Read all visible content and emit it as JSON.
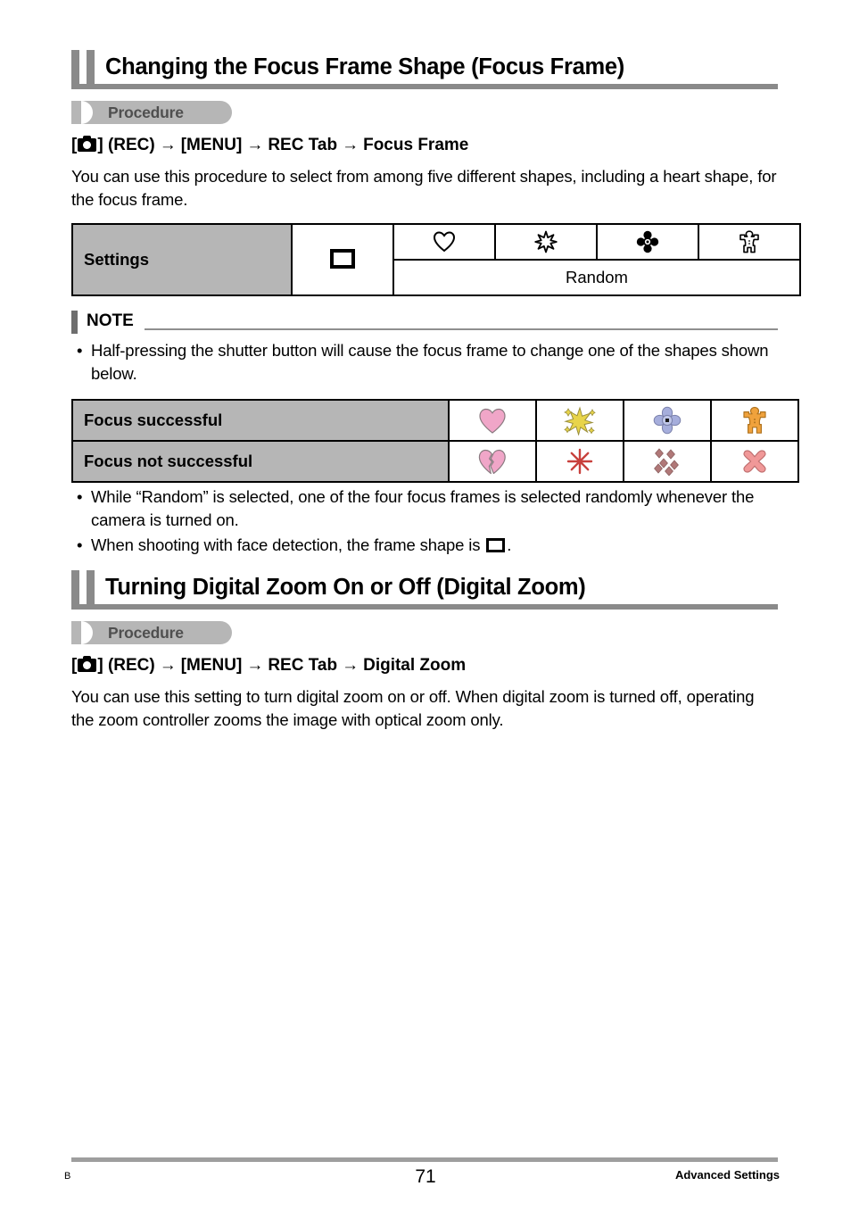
{
  "sections": [
    {
      "title": "Changing the Focus Frame Shape (Focus Frame)",
      "procedure_label": "Procedure",
      "path": {
        "camera_icon": "camera-icon",
        "open_bracket": "[",
        "close_bracket": "]",
        "rec": "(REC)",
        "menu": "[MENU]",
        "tab": "REC Tab",
        "item": "Focus Frame",
        "arrow": "→"
      },
      "body": "You can use this procedure to select from among five different shapes, including a heart shape, for the focus frame."
    },
    {
      "title": "Turning Digital Zoom On or Off (Digital Zoom)",
      "procedure_label": "Procedure",
      "path": {
        "camera_icon": "camera-icon",
        "open_bracket": "[",
        "close_bracket": "]",
        "rec": "(REC)",
        "menu": "[MENU]",
        "tab": "REC Tab",
        "item": "Digital Zoom",
        "arrow": "→"
      },
      "body": "You can use this setting to turn digital zoom on or off. When digital zoom is turned off, operating the zoom controller zooms the image with optical zoom only."
    }
  ],
  "settings_table": {
    "row_label": "Settings",
    "bracket_icon": "focus-frame-bracket-icon",
    "shape_icons": [
      "heart-outline-icon",
      "sparkle-outline-icon",
      "flower-outline-icon",
      "gingerbread-outline-icon"
    ],
    "random_label": "Random"
  },
  "note": {
    "label": "NOTE",
    "bullet": "Half-pressing the shutter button will cause the focus frame to change one of the shapes shown below."
  },
  "focus_table": {
    "rows": [
      {
        "label": "Focus successful",
        "icons": [
          "heart-pink-icon",
          "sparkle-gold-icon",
          "flower-blue-icon",
          "gingerbread-orange-icon"
        ]
      },
      {
        "label": "Focus not successful",
        "icons": [
          "broken-heart-icon",
          "burst-red-icon",
          "scattered-petals-icon",
          "cross-pink-icon"
        ]
      }
    ]
  },
  "bullets": [
    {
      "text_before": "While “Random” is selected, one of the four focus frames is selected randomly whenever the camera is turned on.",
      "has_bracket": false,
      "text_after": ""
    },
    {
      "text_before": "When shooting with face detection, the frame shape is ",
      "has_bracket": true,
      "text_after": "."
    }
  ],
  "footer": {
    "left": "B",
    "page_number": "71",
    "right": "Advanced Settings"
  },
  "colors": {
    "heading_bar": "#8a8a8a",
    "table_label_bg": "#b6b6b6",
    "procedure_bg": "#b6b6b6",
    "procedure_text": "#4f4f4f",
    "note_bar": "#6e6e6e",
    "footer_rule": "#9e9e9e",
    "heart_pink": "#F0A6C8",
    "sparkle_gold": "#E8D44A",
    "flower_blue": "#A6AEDC",
    "gingerbread_orange": "#F0A23C",
    "burst_red": "#C8403C",
    "petals_rose": "#B07878",
    "cross_pink": "#F09898"
  }
}
